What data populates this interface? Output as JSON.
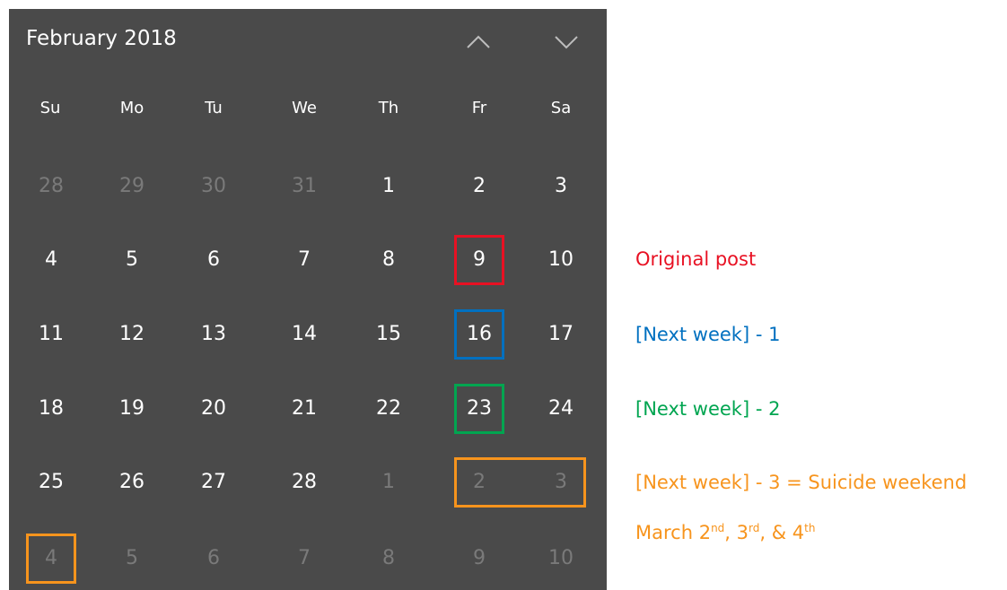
{
  "calendar": {
    "month_title": "February 2018",
    "nav_up_icon": "chevron-up-icon",
    "nav_down_icon": "chevron-down-icon",
    "weekdays": [
      "Su",
      "Mo",
      "Tu",
      "We",
      "Th",
      "Fr",
      "Sa"
    ],
    "weeks": [
      [
        {
          "d": "28",
          "o": true
        },
        {
          "d": "29",
          "o": true
        },
        {
          "d": "30",
          "o": true
        },
        {
          "d": "31",
          "o": true
        },
        {
          "d": "1",
          "o": false
        },
        {
          "d": "2",
          "o": false
        },
        {
          "d": "3",
          "o": false
        }
      ],
      [
        {
          "d": "4",
          "o": false
        },
        {
          "d": "5",
          "o": false
        },
        {
          "d": "6",
          "o": false
        },
        {
          "d": "7",
          "o": false
        },
        {
          "d": "8",
          "o": false
        },
        {
          "d": "9",
          "o": false
        },
        {
          "d": "10",
          "o": false
        }
      ],
      [
        {
          "d": "11",
          "o": false
        },
        {
          "d": "12",
          "o": false
        },
        {
          "d": "13",
          "o": false
        },
        {
          "d": "14",
          "o": false
        },
        {
          "d": "15",
          "o": false
        },
        {
          "d": "16",
          "o": false
        },
        {
          "d": "17",
          "o": false
        }
      ],
      [
        {
          "d": "18",
          "o": false
        },
        {
          "d": "19",
          "o": false
        },
        {
          "d": "20",
          "o": false
        },
        {
          "d": "21",
          "o": false
        },
        {
          "d": "22",
          "o": false
        },
        {
          "d": "23",
          "o": false
        },
        {
          "d": "24",
          "o": false
        }
      ],
      [
        {
          "d": "25",
          "o": false
        },
        {
          "d": "26",
          "o": false
        },
        {
          "d": "27",
          "o": false
        },
        {
          "d": "28",
          "o": false
        },
        {
          "d": "1",
          "o": true
        },
        {
          "d": "2",
          "o": true
        },
        {
          "d": "3",
          "o": true
        }
      ],
      [
        {
          "d": "4",
          "o": true
        },
        {
          "d": "5",
          "o": true
        },
        {
          "d": "6",
          "o": true
        },
        {
          "d": "7",
          "o": true
        },
        {
          "d": "8",
          "o": true
        },
        {
          "d": "9",
          "o": true
        },
        {
          "d": "10",
          "o": true
        }
      ]
    ],
    "highlights": [
      {
        "week": 1,
        "from": 5,
        "to": 5,
        "color": "#e81123"
      },
      {
        "week": 2,
        "from": 5,
        "to": 5,
        "color": "#0070c0"
      },
      {
        "week": 3,
        "from": 5,
        "to": 5,
        "color": "#00a550"
      },
      {
        "week": 4,
        "from": 5,
        "to": 6,
        "color": "#f7941d"
      },
      {
        "week": 5,
        "from": 0,
        "to": 0,
        "color": "#f7941d"
      }
    ]
  },
  "annotations": {
    "original_post": "Original post",
    "next_week_1": "[Next week] - 1",
    "next_week_2": "[Next week] - 2",
    "next_week_3": "[Next week] - 3 = Suicide weekend",
    "march_line": {
      "p1": "March 2",
      "s1": "nd",
      "p2": ", 3",
      "s2": "rd",
      "p3": ", & 4",
      "s3": "th"
    },
    "colors": {
      "red": "#e81123",
      "blue": "#0070c0",
      "green": "#00a550",
      "orange": "#f7941d"
    }
  }
}
